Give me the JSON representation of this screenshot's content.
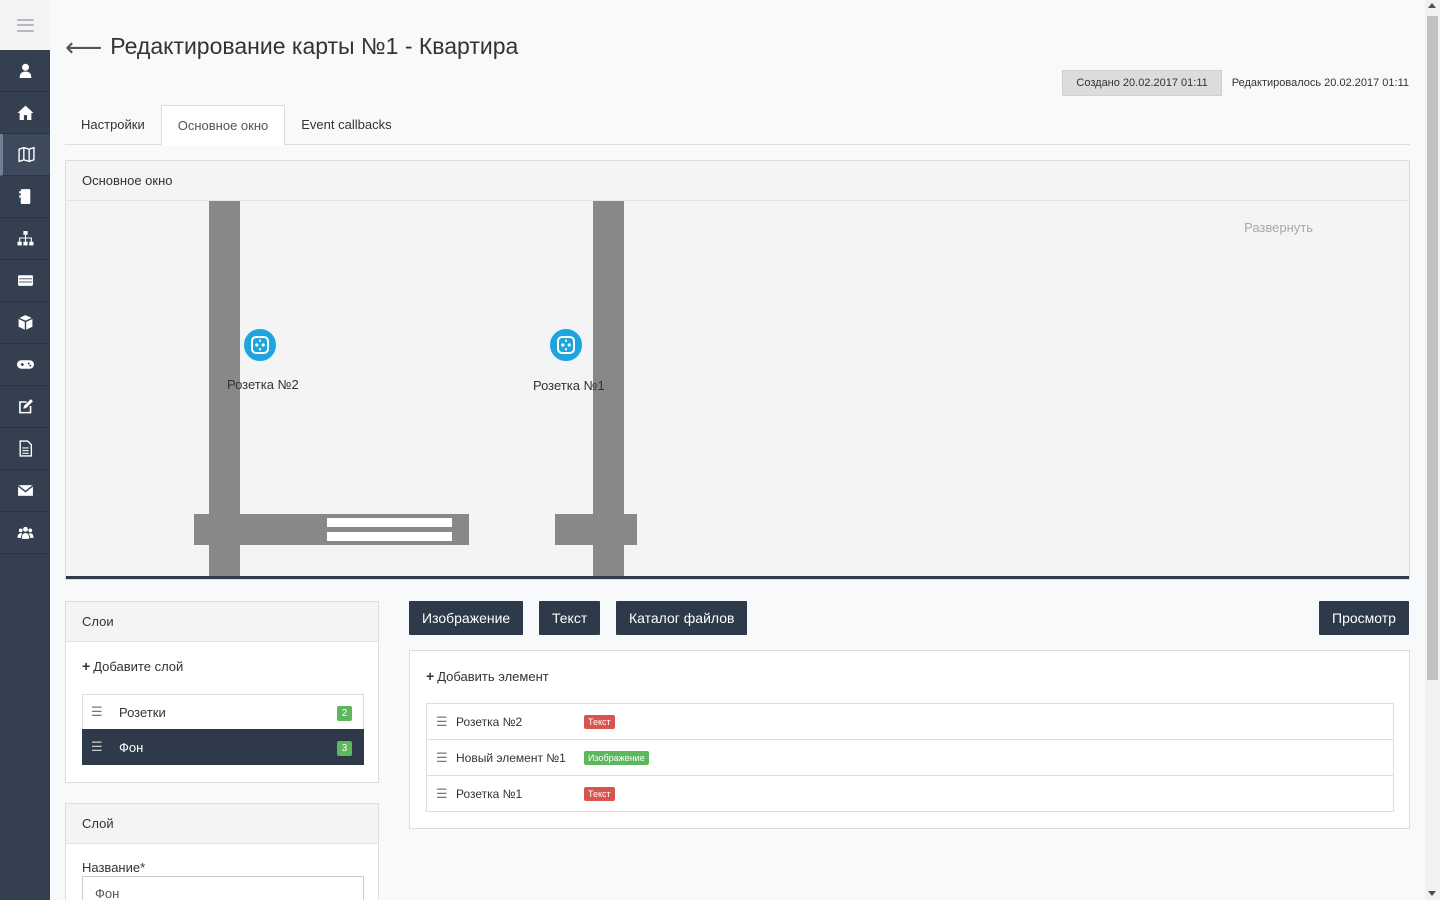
{
  "page": {
    "title": "Редактирование карты №1 - Квартира",
    "created": "Создано 20.02.2017 01:11",
    "edited": "Редактировалось 20.02.2017 01:11"
  },
  "sidebar": {
    "items": [
      {
        "icon": "user-icon"
      },
      {
        "icon": "home-icon"
      },
      {
        "icon": "map-icon",
        "active": true
      },
      {
        "icon": "phone-icon"
      },
      {
        "icon": "sitemap-icon"
      },
      {
        "icon": "list-icon"
      },
      {
        "icon": "cube-icon"
      },
      {
        "icon": "gamepad-icon"
      },
      {
        "icon": "edit-icon"
      },
      {
        "icon": "file-icon"
      },
      {
        "icon": "envelope-icon"
      },
      {
        "icon": "users-icon"
      }
    ]
  },
  "tabs": [
    {
      "label": "Настройки"
    },
    {
      "label": "Основное окно",
      "active": true
    },
    {
      "label": "Event callbacks"
    }
  ],
  "canvas": {
    "header": "Основное окно",
    "expand": "Развернуть",
    "sockets": [
      {
        "label": "Розетка №2"
      },
      {
        "label": "Розетка №1"
      }
    ]
  },
  "layers": {
    "header": "Слои",
    "add": "Добавите слой",
    "items": [
      {
        "name": "Розетки",
        "count": "2"
      },
      {
        "name": "Фон",
        "count": "3",
        "active": true
      }
    ]
  },
  "layer_form": {
    "header": "Слой",
    "name_label": "Название*",
    "name_value": "Фон"
  },
  "toolbar": {
    "image": "Изображение",
    "text": "Текст",
    "catalog": "Каталог файлов",
    "preview": "Просмотр"
  },
  "elements": {
    "add": "Добавить элемент",
    "items": [
      {
        "name": "Розетка №2",
        "tag": "Текст",
        "tag_color": "#d9534f"
      },
      {
        "name": "Новый элемент №1",
        "tag": "Изображение",
        "tag_color": "#5cb85c"
      },
      {
        "name": "Розетка №1",
        "tag": "Текст",
        "tag_color": "#d9534f"
      }
    ]
  }
}
